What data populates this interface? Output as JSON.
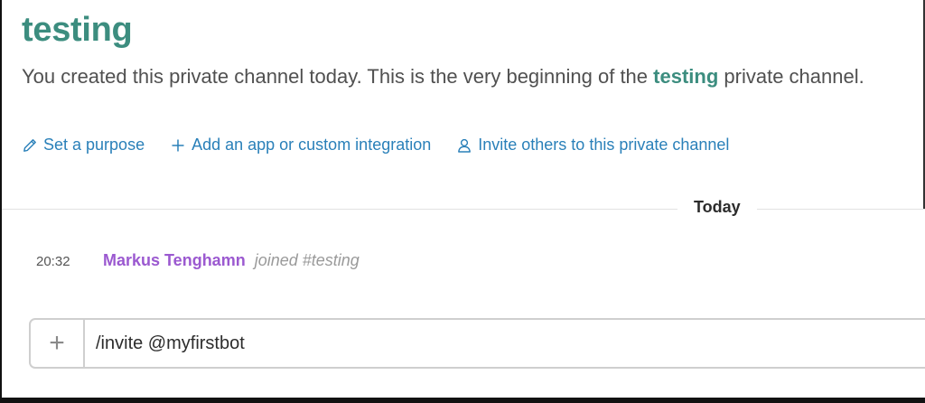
{
  "channel": {
    "name": "testing",
    "intro_prefix": "You created this private channel today. This is the very beginning of the ",
    "intro_link": "testing",
    "intro_suffix": " private channel."
  },
  "actions": [
    {
      "icon": "pencil-icon",
      "label": "Set a purpose"
    },
    {
      "icon": "plus-icon",
      "label": "Add an app or custom integration"
    },
    {
      "icon": "person-icon",
      "label": "Invite others to this private channel"
    }
  ],
  "day_divider": "Today",
  "messages": [
    {
      "time": "20:32",
      "user": "Markus Tenghamn",
      "text": "joined #testing"
    }
  ],
  "composer": {
    "value": "/invite @myfirstbot",
    "plus_label": "+"
  },
  "colors": {
    "channel": "#3c8d7f",
    "link": "#2a80b9",
    "username": "#9b59d0"
  }
}
